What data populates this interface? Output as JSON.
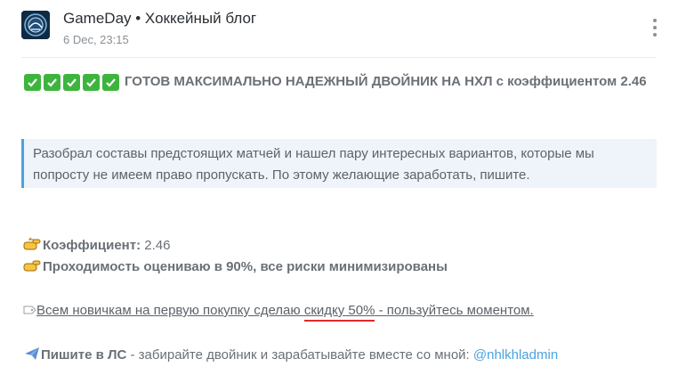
{
  "post": {
    "author": "GameDay • Хоккейный блог",
    "timestamp": "6 Dec, 23:15",
    "title_checks": 5,
    "title": "ГОТОВ МАКСИМАЛЬНО НАДЕЖНЫЙ ДВОЙНИК НА НХЛ с коэффициентом 2.46",
    "quote": "Разобрал составы предстоящих матчей и нашел пару интересных вариантов, которые мы попросту не имеем право пропускать. По этому желающие заработать, пишите.",
    "odds_label": "Коэффициент:",
    "odds_value": "2.46",
    "pass_rate_text": "Проходимость оцениваю в 90%, все риски минимизированы",
    "promo_prefix": "Всем новичкам на первую покупку сделаю ",
    "promo_highlight": "скидку 50%",
    "promo_suffix": " - пользуйтесь моментом.",
    "dm_label": "Пишите в ЛС",
    "dm_text": " - забирайте двойник и зарабатывайте вместе со мной: ",
    "dm_handle": "@nhlkhladmin"
  },
  "icons": {
    "avatar": "team-logo-icon",
    "menu": "more-vertical-icon",
    "checks": "check-mark-icon",
    "pointer": "pointing-hand-icon",
    "tag": "label-tag-icon",
    "plane": "airplane-icon"
  },
  "colors": {
    "accent": "#4aa3df",
    "check": "#3db53d",
    "underline_red": "#e0292f"
  }
}
